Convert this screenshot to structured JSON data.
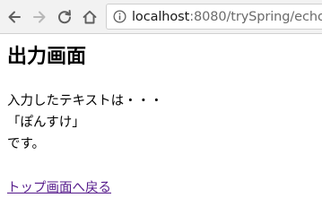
{
  "browser": {
    "url_host": "localhost",
    "url_rest": ":8080/trySpring/echo",
    "icons": {
      "back": "arrow-left-icon",
      "forward": "arrow-right-icon",
      "reload": "reload-icon",
      "home": "home-icon",
      "site_info": "info-icon"
    }
  },
  "page": {
    "heading": "出力画面",
    "line1": "入力したテキストは・・・",
    "line2": "「ぽんすけ」",
    "line3": "です。",
    "back_link": "トップ画面へ戻る"
  },
  "colors": {
    "toolbar_bg": "#f2f2f2",
    "visited_link": "#551a8b"
  }
}
